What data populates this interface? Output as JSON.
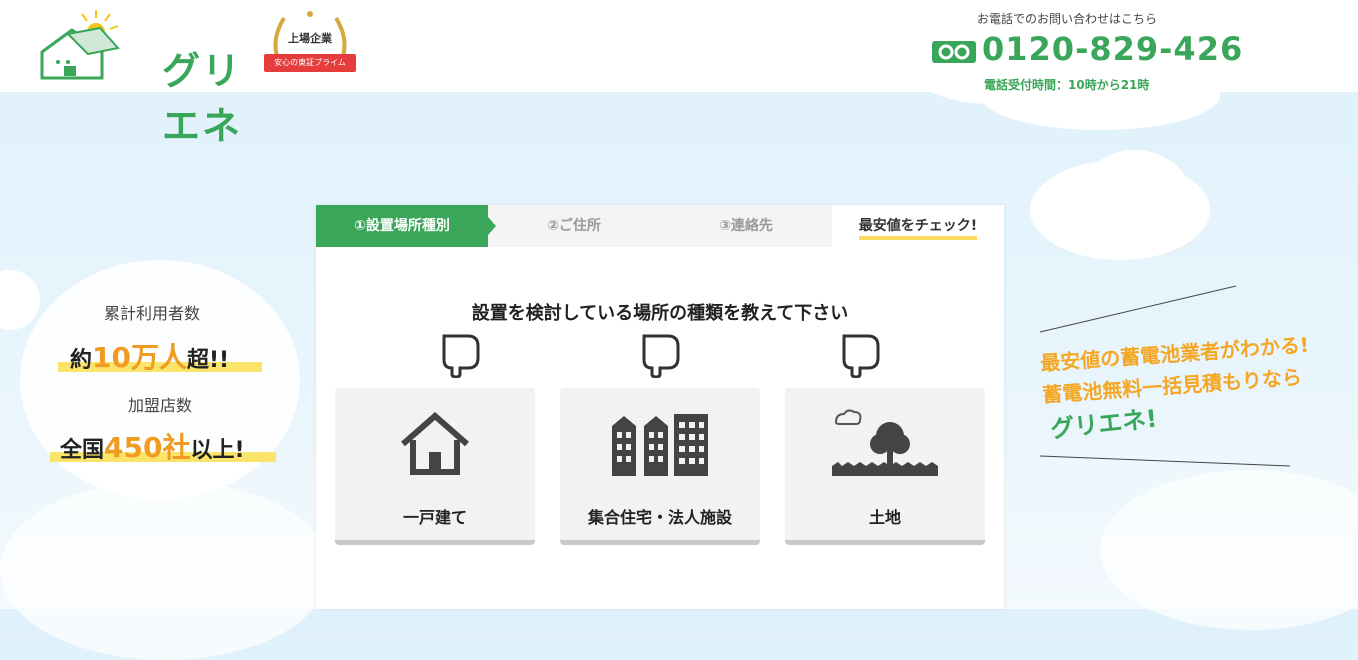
{
  "header": {
    "logo_text": "グリエネ",
    "badge_top": "上場企業",
    "badge_ribbon": "安心の東証プライム",
    "phone_label": "お電話でのお問い合わせはこちら",
    "phone_number": "0120-829-426",
    "phone_hours": "電話受付時間：10時から21時"
  },
  "stats": {
    "users_label": "累計利用者数",
    "users_prefix": "約",
    "users_value": "10万人",
    "users_suffix": "超!!",
    "shops_label": "加盟店数",
    "shops_prefix": "全国",
    "shops_value": "450社",
    "shops_suffix": "以上!"
  },
  "steps": [
    {
      "label": "①設置場所種別"
    },
    {
      "label": "②ご住所"
    },
    {
      "label": "③連絡先"
    },
    {
      "label": "最安値をチェック!"
    }
  ],
  "question": "設置を検討している場所の種類を教えて下さい",
  "choices": [
    {
      "label": "一戸建て"
    },
    {
      "label": "集合住宅・法人施設"
    },
    {
      "label": "土地"
    }
  ],
  "promo": {
    "line1": "最安値の蓄電池業者がわかる!",
    "line2": "蓄電池無料一括見積もりなら",
    "line3": "グリエネ!"
  },
  "colors": {
    "brand_green": "#3aa65a",
    "accent_orange": "#f5a623",
    "highlight_yellow": "#fbe46a"
  }
}
